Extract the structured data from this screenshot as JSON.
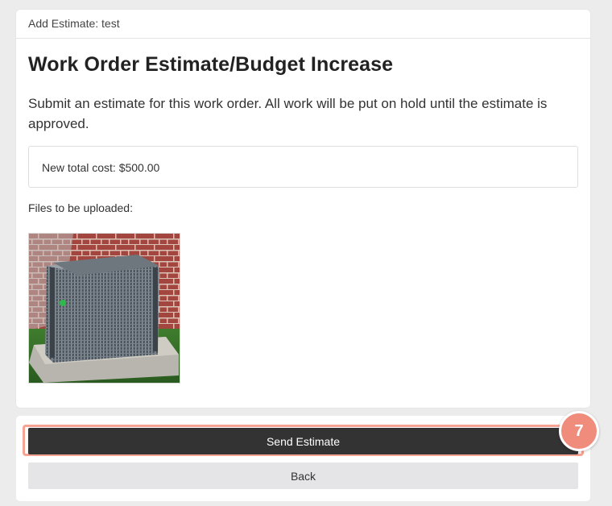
{
  "header": {
    "title": "Add Estimate: test"
  },
  "main": {
    "heading": "Work Order Estimate/Budget Increase",
    "description": "Submit an estimate for this work order. All work will be put on hold until the estimate is approved.",
    "cost_text": "New total cost: $500.00",
    "files_label": "Files to be uploaded:",
    "files": [
      {
        "icon": "air-conditioner-image"
      }
    ]
  },
  "actions": {
    "send_label": "Send Estimate",
    "back_label": "Back"
  },
  "step_badge": {
    "number": "7"
  },
  "colors": {
    "primary_button": "#333333",
    "secondary_button": "#e5e5e7",
    "highlight": "#f6a393",
    "badge": "#f08c7b"
  }
}
